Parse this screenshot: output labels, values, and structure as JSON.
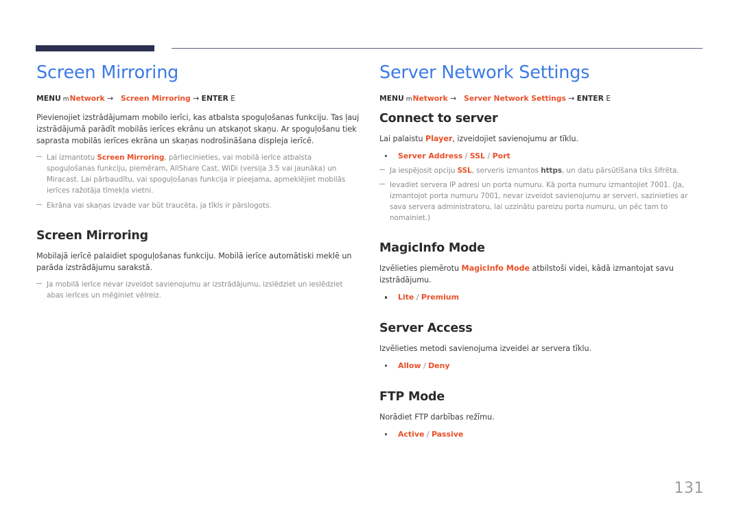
{
  "page": {
    "number": "131"
  },
  "left_column": {
    "chapter_title": "Screen Mirroring",
    "menu_path": {
      "menu_label": "MENU",
      "glyph": "m",
      "root": "Network",
      "arrow1": "→",
      "target": "Screen Mirroring",
      "arrow2": "→",
      "enter_label": "ENTER",
      "enter_key": "E"
    },
    "intro": {
      "text": "Pievienojiet izstrādājumam mobilo ierīci, kas atbalsta spoguļošanas funkciju. Tas ļauj izstrādājumā parādīt mobilās ierīces ekrānu un atskaņot skaņu. Ar spoguļošanu tiek saprasta mobilās ierīces ekrāna un skaņas nodrošināšana displeja ierīcē."
    },
    "intro_notes": [
      {
        "part1": "Lai izmantotu ",
        "accent": "Screen Mirroring",
        "part2": ", pārliecinieties, vai mobilā ierīce atbalsta spoguļošanas funkciju, piemēram, AllShare Cast, WiDi (versija 3.5 vai jaunāka) un Miracast. Lai pārbaudītu, vai spoguļošanas funkcija ir pieejama, apmeklējiet mobilās ierīces ražotāja tīmekļa vietni."
      },
      {
        "part1": "Ekrāna vai skaņas izvade var būt traucēta, ja tīkls ir pārslogots.",
        "accent": "",
        "part2": ""
      }
    ],
    "section": {
      "heading": "Screen Mirroring",
      "body": "Mobilajā ierīcē palaidiet spoguļošanas funkciju. Mobilā ierīce automātiski meklē un parāda izstrādājumu sarakstā.",
      "notes": [
        {
          "part1": "Ja mobilā ierīce nevar izveidot savienojumu ar izstrādājumu, izslēdziet un ieslēdziet abas ierīces un mēģiniet vēlreiz.",
          "accent": "",
          "part2": ""
        }
      ]
    }
  },
  "right_column": {
    "chapter_title": "Server Network Settings",
    "menu_path": {
      "menu_label": "MENU",
      "glyph": "m",
      "root": "Network",
      "arrow1": "→",
      "target": "Server Network Settings",
      "arrow2": "→",
      "enter_label": "ENTER",
      "enter_key": "E"
    },
    "sections": [
      {
        "heading": "Connect to server",
        "body_part1": "Lai palaistu ",
        "body_accent": "Player",
        "body_part2": ", izveidojiet savienojumu ar tīklu.",
        "options": [
          {
            "values": [
              "Server Address",
              "SSL",
              "Port"
            ],
            "separator": " / "
          }
        ],
        "notes": [
          {
            "part1": "Ja iespējosit opciju ",
            "accent": "SSL",
            "part2": ", serveris izmantos ",
            "bold": "https",
            "part3": ", un datu pārsūtīšana tiks šifrēta."
          },
          {
            "part1": "Ievadiet servera IP adresi un porta numuru. Kā porta numuru izmantojiet 7001. (Ja, izmantojot porta numuru 7001, nevar izveidot savienojumu ar serveri, sazinieties ar sava servera administratoru, lai uzzinātu pareizu porta numuru, un pēc tam to nomainiet.)",
            "accent": "",
            "part2": "",
            "bold": "",
            "part3": ""
          }
        ]
      },
      {
        "heading": "MagicInfo Mode",
        "body_part1": "Izvēlieties piemērotu ",
        "body_accent": "MagicInfo Mode",
        "body_part2": " atbilstoši videi, kādā izmantojat savu izstrādājumu.",
        "options": [
          {
            "values": [
              "Lite",
              "Premium"
            ],
            "separator": " / "
          }
        ],
        "notes": []
      },
      {
        "heading": "Server Access",
        "body_part1": "Izvēlieties metodi savienojuma izveidei ar servera tīklu.",
        "body_accent": "",
        "body_part2": "",
        "options": [
          {
            "values": [
              "Allow",
              "Deny"
            ],
            "separator": " / "
          }
        ],
        "notes": []
      },
      {
        "heading": "FTP Mode",
        "body_part1": "Norādiet FTP darbības režīmu.",
        "body_accent": "",
        "body_part2": "",
        "options": [
          {
            "values": [
              "Active",
              "Passive"
            ],
            "separator": " / "
          }
        ],
        "notes": []
      }
    ]
  },
  "colors": {
    "heading_blue": "#3c7ae4",
    "accent_orange": "#e8512a",
    "rule_navy": "#2b3050",
    "rule_thin": "#5b5f7e",
    "body_gray": "#3b3b3b",
    "note_gray": "#8c8c8c",
    "page_number_gray": "#9b9b9b"
  }
}
